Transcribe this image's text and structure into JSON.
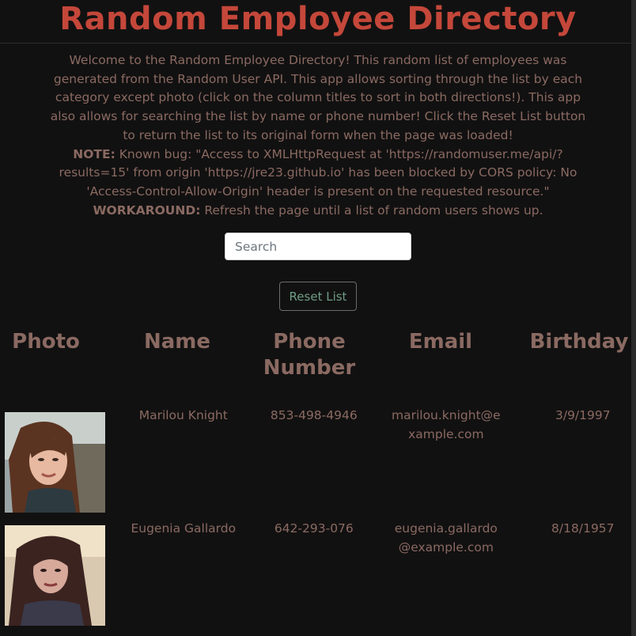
{
  "header": {
    "title": "Random Employee Directory"
  },
  "intro": {
    "paragraph": "Welcome to the Random Employee Directory! This random list of employees was generated from the Random User API. This app allows sorting through the list by each category except photo (click on the column titles to sort in both directions!). This app also allows for searching the list by name or phone number! Click the Reset List button to return the list to its original form when the page was loaded!",
    "note_label": "NOTE:",
    "note_text": " Known bug: \"Access to XMLHttpRequest at 'https://randomuser.me/api/?results=15' from origin 'https://jre23.github.io' has been blocked by CORS policy: No 'Access-Control-Allow-Origin' header is present on the requested resource.\"",
    "workaround_label": "WORKAROUND:",
    "workaround_text": " Refresh the page until a list of random users shows up."
  },
  "search": {
    "placeholder": "Search",
    "value": ""
  },
  "reset": {
    "label": "Reset List"
  },
  "table": {
    "columns": {
      "photo": "Photo",
      "name": "Name",
      "phone": "Phone Number",
      "email": "Email",
      "birthday": "Birthday"
    },
    "rows": [
      {
        "name": "Marilou Knight",
        "phone": "853-498-4946",
        "email": "marilou.knight@example.com",
        "birthday": "3/9/1997"
      },
      {
        "name": "Eugenia Gallardo",
        "phone": "642-293-076",
        "email": "eugenia.gallardo@example.com",
        "birthday": "8/18/1957"
      }
    ]
  },
  "colors": {
    "background": "#121111",
    "title": "#c4473a",
    "text": "#8a6a62",
    "reset_text": "#6d9e86"
  }
}
